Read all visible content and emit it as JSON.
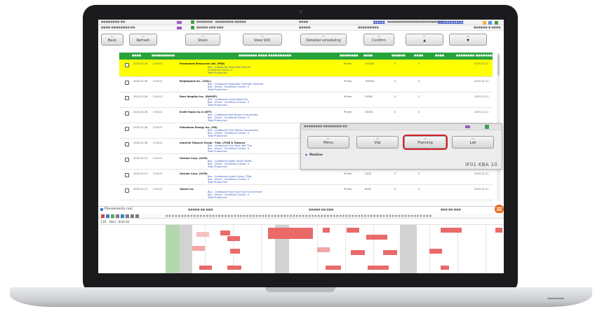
{
  "toolbar": {
    "buttons": [
      {
        "num": "F1",
        "label": "Back"
      },
      {
        "num": "F2",
        "label": "Refresh"
      },
      {
        "num": "F3",
        "label": "Stock"
      },
      {
        "num": "F4",
        "label": "View SOC"
      },
      {
        "num": "F5",
        "label": "Detailed scheduling"
      },
      {
        "num": "F6",
        "label": "Confirm"
      },
      {
        "num": "F7",
        "label": "▲"
      },
      {
        "num": "F8",
        "label": "▼"
      }
    ]
  },
  "table": {
    "rows": [
      {
        "date": "2020-02-26",
        "code": "3.00.01",
        "customer": "Paramount Resources Ltd. (PRA)",
        "lines": [
          "Box - Cardboard Semi-Reel Natural",
          "Undefined Carton: 0",
          "Total Production"
        ],
        "qty": "100000",
        "status": "Printer",
        "date2": "2019-12-31",
        "highlight": true
      },
      {
        "date": "2020-02-26",
        "code": "3.00.01",
        "customer": "Brightpoint Inc. (CELL)",
        "lines": [
          "Box - Cardboard Separator Calendar Volumes",
          "Box - Sheet - Undefined Carton: 0",
          "Total Production"
        ],
        "qty": "100000",
        "status": "Printer",
        "date2": "2019-12-31",
        "highlight": false
      },
      {
        "date": "2020-02-26",
        "code": "3.00.01",
        "customer": "Rare Hospital Inc. (RHOSP)",
        "lines": [
          "Box - Cardboard Labels Black Bo",
          "Box - Sheet - Undefined Carton: 0",
          "Total Production"
        ],
        "qty": "20000",
        "status": "Printer",
        "date2": "2019-12-31",
        "highlight": false
      },
      {
        "date": "2020-02-26",
        "code": "3.00.01",
        "customer": "Kraft Foods Inc A (KFT)",
        "lines": [
          "Box - Cardboard Melt Brown Concentrate",
          "Box - Sheet - Undefined Carton: 0",
          "Total Production"
        ],
        "qty": "30000",
        "status": "Printer",
        "date2": "2019-12-31",
        "highlight": false
      },
      {
        "date": "2020-02-26",
        "code": "3.00.01",
        "customer": "Petroleum Energy Inc. (PN)",
        "lines": [
          "Box - Cardboard Print Yellow Concentrate",
          "Box - Sheet - Undefined Carton: 0",
          "Total Production"
        ],
        "qty": "",
        "status": "",
        "date2": "",
        "highlight": false
      },
      {
        "date": "2020-02-26",
        "code": "3.00.01",
        "customer": "Imperial Tobacco Group - Fwd. (ITOB & Tobacco",
        "lines": [
          "Box - Cardboard Print Town Bell Thg",
          "Box - Sheet - Undefined Carton: 0",
          "Total Production"
        ],
        "qty": "",
        "status": "",
        "date2": "",
        "highlight": false
      },
      {
        "date": "2020-02-27",
        "code": "3.00.01",
        "customer": "Unicom Corp. (UCM)",
        "lines": [
          "Box - Cardboard Water Smile 500ML",
          "Box - Sheet - Undefined Carton: 0",
          "Total Production"
        ],
        "qty": "",
        "status": "",
        "date2": "",
        "highlight": false
      },
      {
        "date": "2020-02-27",
        "code": "3.00.01",
        "customer": "Unicom Corp. (UCM)",
        "lines": [
          "Box - Cardboard Import Spray 75Kg",
          "Box - Sheet - Undefined Carton: 0",
          "Total Production"
        ],
        "qty": "4200",
        "status": "Printer",
        "date2": "2019-12-31",
        "highlight": false
      },
      {
        "date": "2020-02-27",
        "code": "3.00.01",
        "customer": "Xplore Inc",
        "lines": [
          "Box - Cardboard Food Size Blue Concentrate",
          "Box - Sheet - Undefined Carton: 0",
          "Total Production"
        ],
        "qty": "6000",
        "status": "Printer",
        "date2": "2019-12-31",
        "highlight": false
      }
    ]
  },
  "popup": {
    "buttons": [
      {
        "num": "F1",
        "label": "Menu"
      },
      {
        "num": "F2",
        "label": "Vial"
      },
      {
        "num": "F3",
        "label": "Planning",
        "selected": true
      },
      {
        "num": "F4",
        "label": "Lab"
      }
    ],
    "section_label": "Machine",
    "footer": "IF01  KBA 10"
  },
  "gantt": {
    "title": "Planeamento real",
    "row_label": "1.01 - Hexi - Sree fol"
  },
  "colors": {
    "table_header": "#27a33b",
    "highlight_row": "#ffff00",
    "selected_outline": "#d6222c",
    "gantt_bar": "#ea6a6a",
    "action_button": "#f06a1b"
  }
}
